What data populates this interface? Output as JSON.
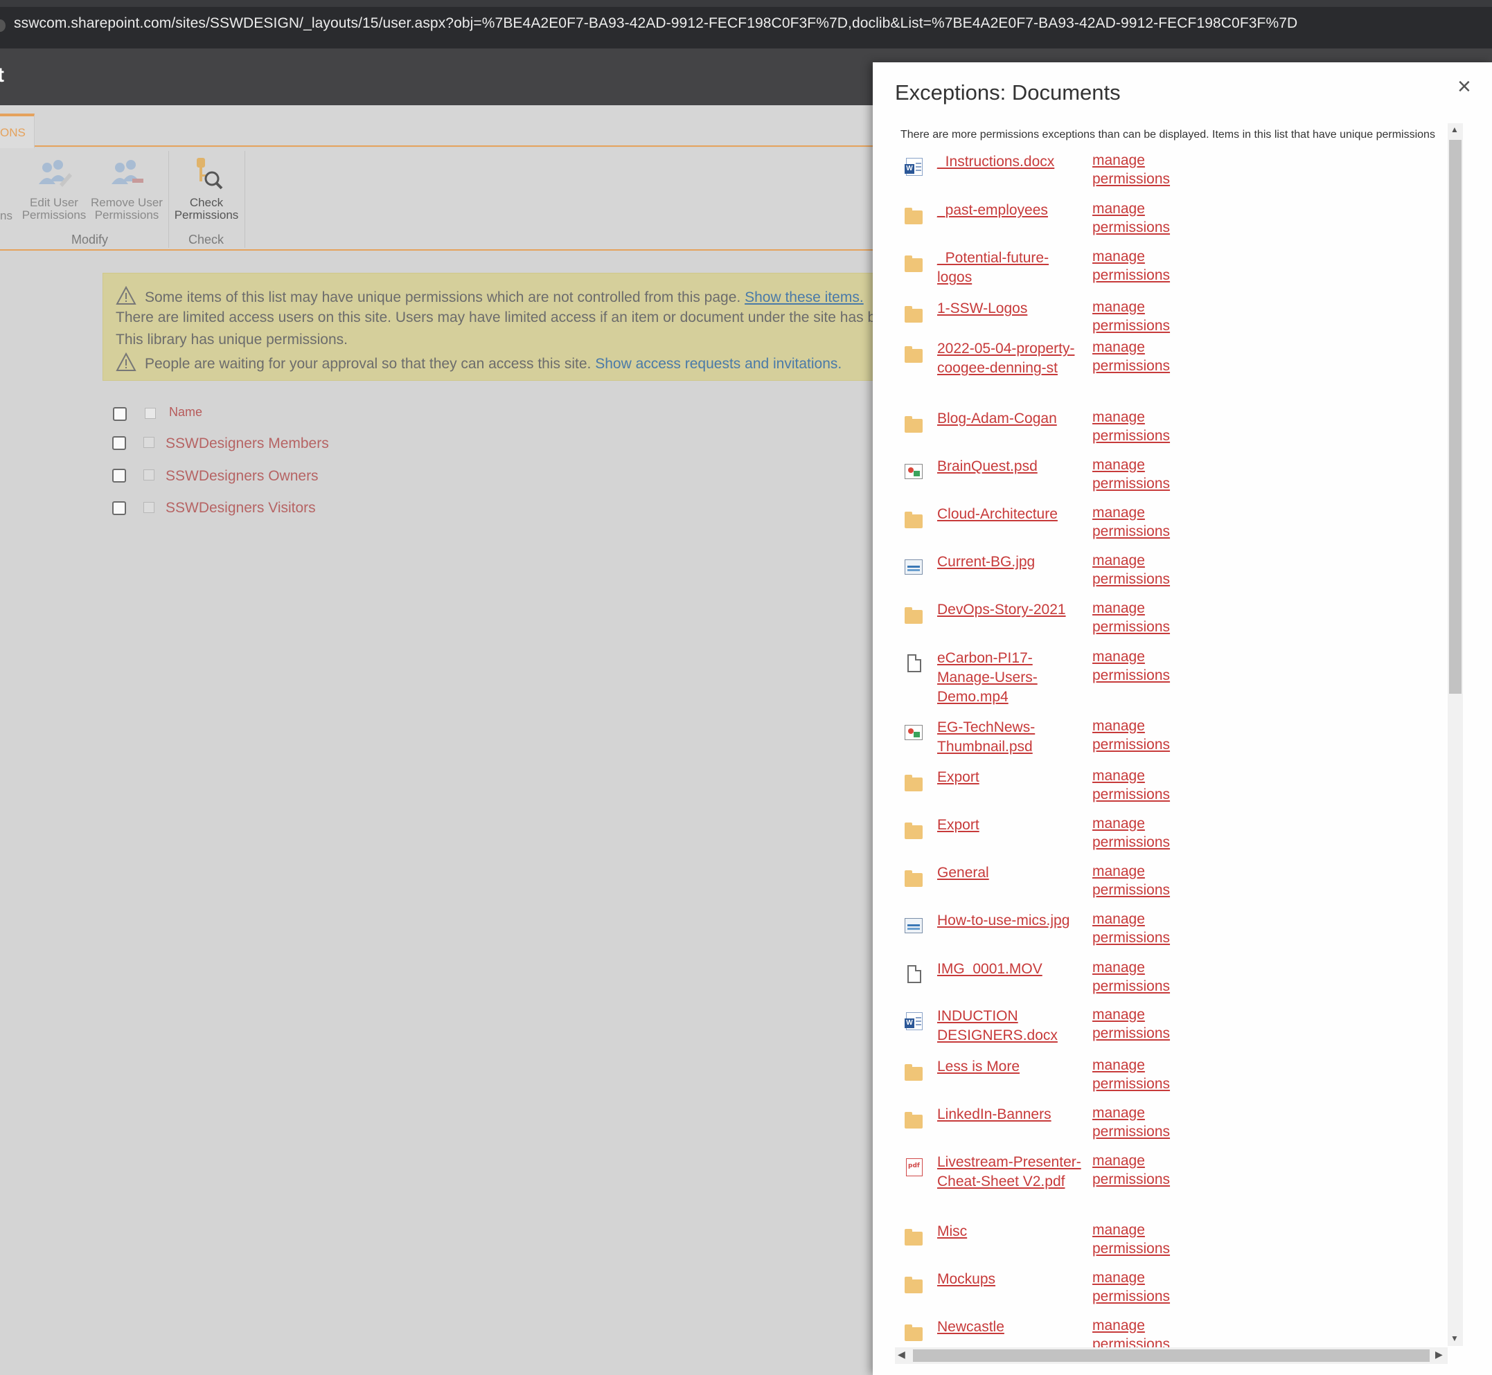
{
  "browser": {
    "url": "sswcom.sharepoint.com/sites/SSWDESIGN/_layouts/15/user.aspx?obj=%7BE4A2E0F7-BA93-42AD-9912-FECF198C0F3F%7D,doclib&List=%7BE4A2E0F7-BA93-42AD-9912-FECF198C0F3F%7D"
  },
  "suite": {
    "title": "t"
  },
  "ribbon": {
    "tab_label": "ONS",
    "partial_label": "ns",
    "edit_user": [
      "Edit User",
      "Permissions"
    ],
    "remove_user": [
      "Remove User",
      "Permissions"
    ],
    "check": [
      "Check",
      "Permissions"
    ],
    "group_modify": "Modify",
    "group_check": "Check"
  },
  "warnings": {
    "line1_text": "Some items of this list may have unique permissions which are not controlled from this page.",
    "line1_link": "Show these items.",
    "line2_text": "There are limited access users on this site. Users may have limited access if an item or document under the site has been shared with them.",
    "line3_text": "This library has unique permissions.",
    "line4_text": "People are waiting for your approval so that they can access this site.",
    "line4_link": "Show access requests and invitations."
  },
  "groups": {
    "header": "Name",
    "items": [
      "SSWDesigners Members",
      "SSWDesigners Owners",
      "SSWDesigners Visitors"
    ]
  },
  "dialog": {
    "title": "Exceptions: Documents",
    "close": "×",
    "note": "There are more permissions exceptions than can be displayed. Items in this list that have unique permissions",
    "manage_label": [
      "manage",
      "permissions"
    ],
    "items": [
      {
        "name": "_Instructions.docx",
        "icon": "word-doc-icon"
      },
      {
        "name": "_past-employees",
        "icon": "folder-icon"
      },
      {
        "name": "_Potential-future-logos",
        "icon": "folder-icon"
      },
      {
        "name": "1-SSW-Logos",
        "icon": "folder-icon"
      },
      {
        "name": "2022-05-04-property-coogee-denning-st",
        "icon": "folder-icon"
      },
      {
        "name": "Blog-Adam-Cogan",
        "icon": "folder-icon"
      },
      {
        "name": "BrainQuest.psd",
        "icon": "psd-icon"
      },
      {
        "name": "Cloud-Architecture",
        "icon": "folder-icon"
      },
      {
        "name": "Current-BG.jpg",
        "icon": "image-icon"
      },
      {
        "name": "DevOps-Story-2021",
        "icon": "folder-icon"
      },
      {
        "name": "eCarbon-PI17-Manage-Users-Demo.mp4",
        "icon": "file-icon"
      },
      {
        "name": "EG-TechNews-Thumbnail.psd",
        "icon": "psd-icon"
      },
      {
        "name": "Export",
        "icon": "folder-icon"
      },
      {
        "name": "Export",
        "icon": "folder-icon"
      },
      {
        "name": "General",
        "icon": "folder-icon"
      },
      {
        "name": "How-to-use-mics.jpg",
        "icon": "image-icon"
      },
      {
        "name": "IMG_0001.MOV",
        "icon": "file-icon"
      },
      {
        "name": "INDUCTION DESIGNERS.docx",
        "icon": "word-doc-icon"
      },
      {
        "name": "Less is More",
        "icon": "folder-icon"
      },
      {
        "name": "LinkedIn-Banners",
        "icon": "folder-icon"
      },
      {
        "name": "Livestream-Presenter-Cheat-Sheet V2.pdf",
        "icon": "pdf-icon"
      },
      {
        "name": "Misc",
        "icon": "folder-icon"
      },
      {
        "name": "Mockups",
        "icon": "folder-icon"
      },
      {
        "name": "Newcastle",
        "icon": "folder-icon"
      }
    ]
  }
}
